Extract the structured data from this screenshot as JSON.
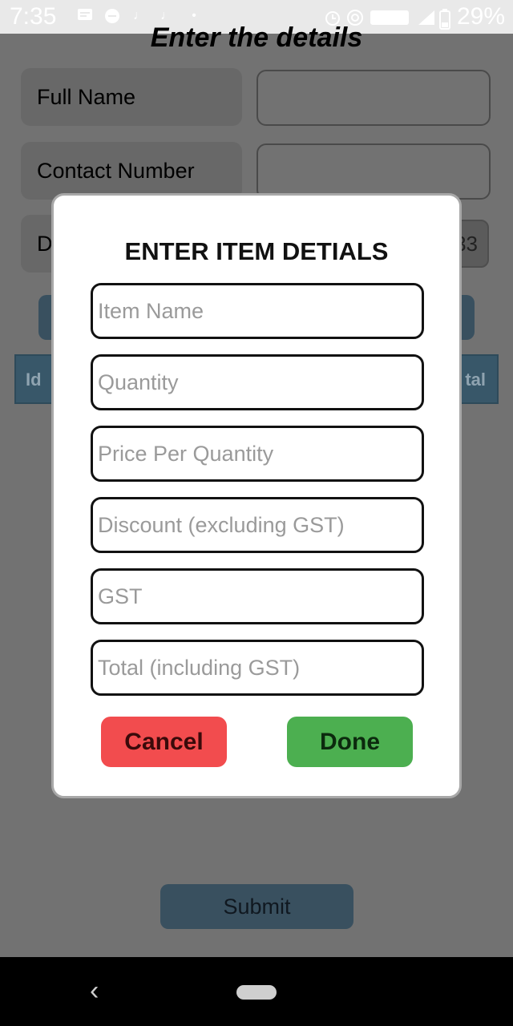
{
  "status_bar": {
    "time": "7:35",
    "battery_percent": "29%",
    "icons_left": [
      "message-icon",
      "chat-icon",
      "music-note-icon",
      "music-note-icon",
      "dot-icon"
    ],
    "icons_right": [
      "alarm-icon",
      "hotspot-icon",
      "volte-icon",
      "signal-icon",
      "battery-icon"
    ]
  },
  "background_form": {
    "title": "Enter the details",
    "full_name_label": "Full Name",
    "contact_number_label": "Contact Number",
    "date_label_partial": "D",
    "date_value_partial": "33",
    "table_headers": {
      "id": "Id",
      "total_partial": "tal"
    },
    "submit_label": "Submit"
  },
  "dialog": {
    "title": "ENTER ITEM DETIALS",
    "fields": [
      {
        "name": "item-name",
        "placeholder": "Item Name"
      },
      {
        "name": "quantity",
        "placeholder": "Quantity"
      },
      {
        "name": "price-per-quantity",
        "placeholder": "Price Per Quantity"
      },
      {
        "name": "discount",
        "placeholder": "Discount (excluding GST)"
      },
      {
        "name": "gst",
        "placeholder": "GST"
      },
      {
        "name": "total",
        "placeholder": "Total (including GST)"
      }
    ],
    "cancel_label": "Cancel",
    "done_label": "Done"
  },
  "nav_bar": {
    "back_icon": "chevron-left-icon",
    "home_icon": "home-pill-icon"
  },
  "colors": {
    "overlay": "#727272",
    "cancel": "#f24c4e",
    "done": "#4caf50",
    "primary_button": "#39505f"
  }
}
